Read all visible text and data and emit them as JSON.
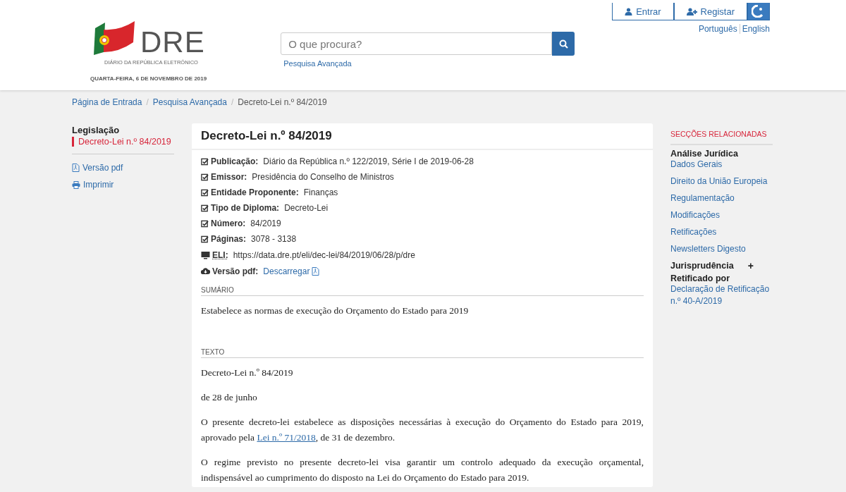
{
  "header": {
    "logo_text": "DRE",
    "logo_subtitle": "DIÁRIO DA REPÚBLICA ELETRÓNICO",
    "date": "QUARTA-FEIRA, 6 DE NOVEMBRO DE 2019",
    "search": {
      "placeholder": "O que procura?",
      "advanced_link": "Pesquisa Avançada"
    },
    "account_buttons": [
      {
        "kind": "user",
        "label": "Entrar"
      },
      {
        "kind": "user-plus",
        "label": "Registar"
      },
      {
        "kind": "accessibility"
      }
    ],
    "languages": [
      "Português",
      "English"
    ]
  },
  "breadcrumb": {
    "separator": "/",
    "items": [
      "Página de Entrada",
      "Pesquisa Avançada",
      "Decreto-Lei n.º 84/2019"
    ]
  },
  "left_nav": {
    "heading": "Legislação",
    "items": [
      {
        "label": "Decreto-Lei n.º 84/2019",
        "selected": true
      }
    ],
    "actions": [
      {
        "kind": "pdf",
        "label": "Versão pdf"
      },
      {
        "kind": "print",
        "label": "Imprimir"
      }
    ]
  },
  "document": {
    "title": "Decreto-Lei n.º 84/2019",
    "metadata": [
      {
        "kind": "check",
        "label": "Publicação:",
        "value": "Diário da República n.º 122/2019, Série I de 2019-06-28"
      },
      {
        "kind": "check",
        "label": "Emissor:",
        "value": "Presidência do Conselho de Ministros"
      },
      {
        "kind": "check",
        "label": "Entidade Proponente:",
        "value": "Finanças"
      },
      {
        "kind": "check",
        "label": "Tipo de Diploma:",
        "value": "Decreto-Lei"
      },
      {
        "kind": "check",
        "label": "Número:",
        "value": "84/2019"
      },
      {
        "kind": "check",
        "label": "Páginas:",
        "value": "3078 - 3138"
      },
      {
        "kind": "eli",
        "label": "ELI:",
        "value": "https://data.dre.pt/eli/dec-lei/84/2019/06/28/p/dre"
      },
      {
        "kind": "download",
        "label": "Versão pdf:",
        "link": "Descarregar"
      }
    ],
    "summary_heading": "SUMÁRIO",
    "summary": "Estabelece as normas de execução do Orçamento do Estado para 2019",
    "text_heading": "TEXTO",
    "paragraphs": [
      {
        "text": "Decreto-Lei n.º 84/2019"
      },
      {
        "text": "de 28 de junho"
      },
      {
        "text": "O presente decreto-lei estabelece as disposições necessárias à execução do Orçamento do Estado para 2019, aprovado pela ",
        "link": "Lei n.º 71/2018",
        "after": ", de 31 de dezembro."
      },
      {
        "text": "O regime previsto no presente decreto-lei visa garantir um controlo adequado da execução orçamental, indispensável ao cumprimento do disposto na Lei do Orçamento do Estado para 2019."
      }
    ]
  },
  "related": {
    "heading": "SECÇÕES RELACIONADAS",
    "groups": [
      {
        "title": "Análise Jurídica",
        "links": [
          "Dados Gerais",
          "Direito da União Europeia",
          "Regulamentação",
          "Modificações",
          "Retificações",
          "Newsletters Digesto"
        ]
      },
      {
        "title": "Jurisprudência",
        "toggle": "+"
      },
      {
        "title": "Retificado por",
        "links": [
          "Declaração de Retificação n.º 40-A/2019"
        ]
      }
    ]
  }
}
